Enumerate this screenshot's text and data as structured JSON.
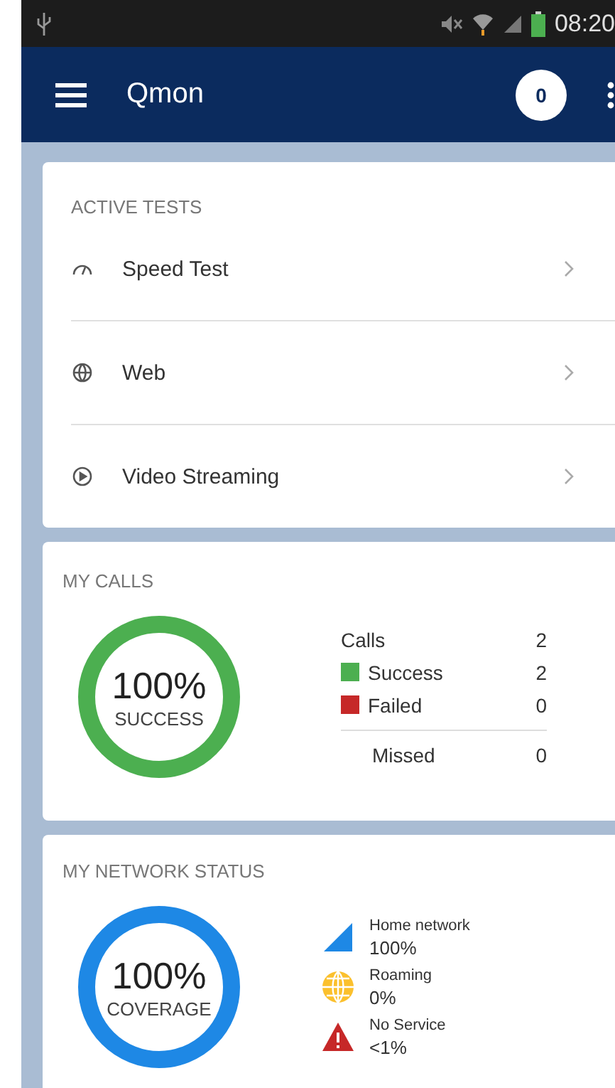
{
  "status_bar": {
    "time": "08:20"
  },
  "app_bar": {
    "title": "Qmon",
    "badge": "0"
  },
  "active_tests": {
    "heading": "ACTIVE TESTS",
    "items": [
      {
        "label": "Speed Test",
        "kind": "speed"
      },
      {
        "label": "Web",
        "kind": "web"
      },
      {
        "label": "Video Streaming",
        "kind": "video"
      }
    ]
  },
  "my_calls": {
    "heading": "MY CALLS",
    "ring": {
      "value": "100%",
      "caption": "SUCCESS"
    },
    "rows": [
      {
        "label": "Calls",
        "value": "2",
        "kind": "total"
      },
      {
        "label": "Success",
        "value": "2",
        "kind": "legend",
        "color": "#4caf50"
      },
      {
        "label": "Failed",
        "value": "0",
        "kind": "legend",
        "color": "#c62828"
      },
      {
        "label": "Missed",
        "value": "0",
        "kind": "missed"
      }
    ]
  },
  "network_status": {
    "heading": "MY NETWORK STATUS",
    "ring": {
      "value": "100%",
      "caption": "COVERAGE"
    },
    "items": [
      {
        "label": "Home network",
        "value": "100%",
        "kind": "home"
      },
      {
        "label": "Roaming",
        "value": "0%",
        "kind": "roaming"
      },
      {
        "label": "No Service",
        "value": "<1%",
        "kind": "none"
      }
    ]
  }
}
